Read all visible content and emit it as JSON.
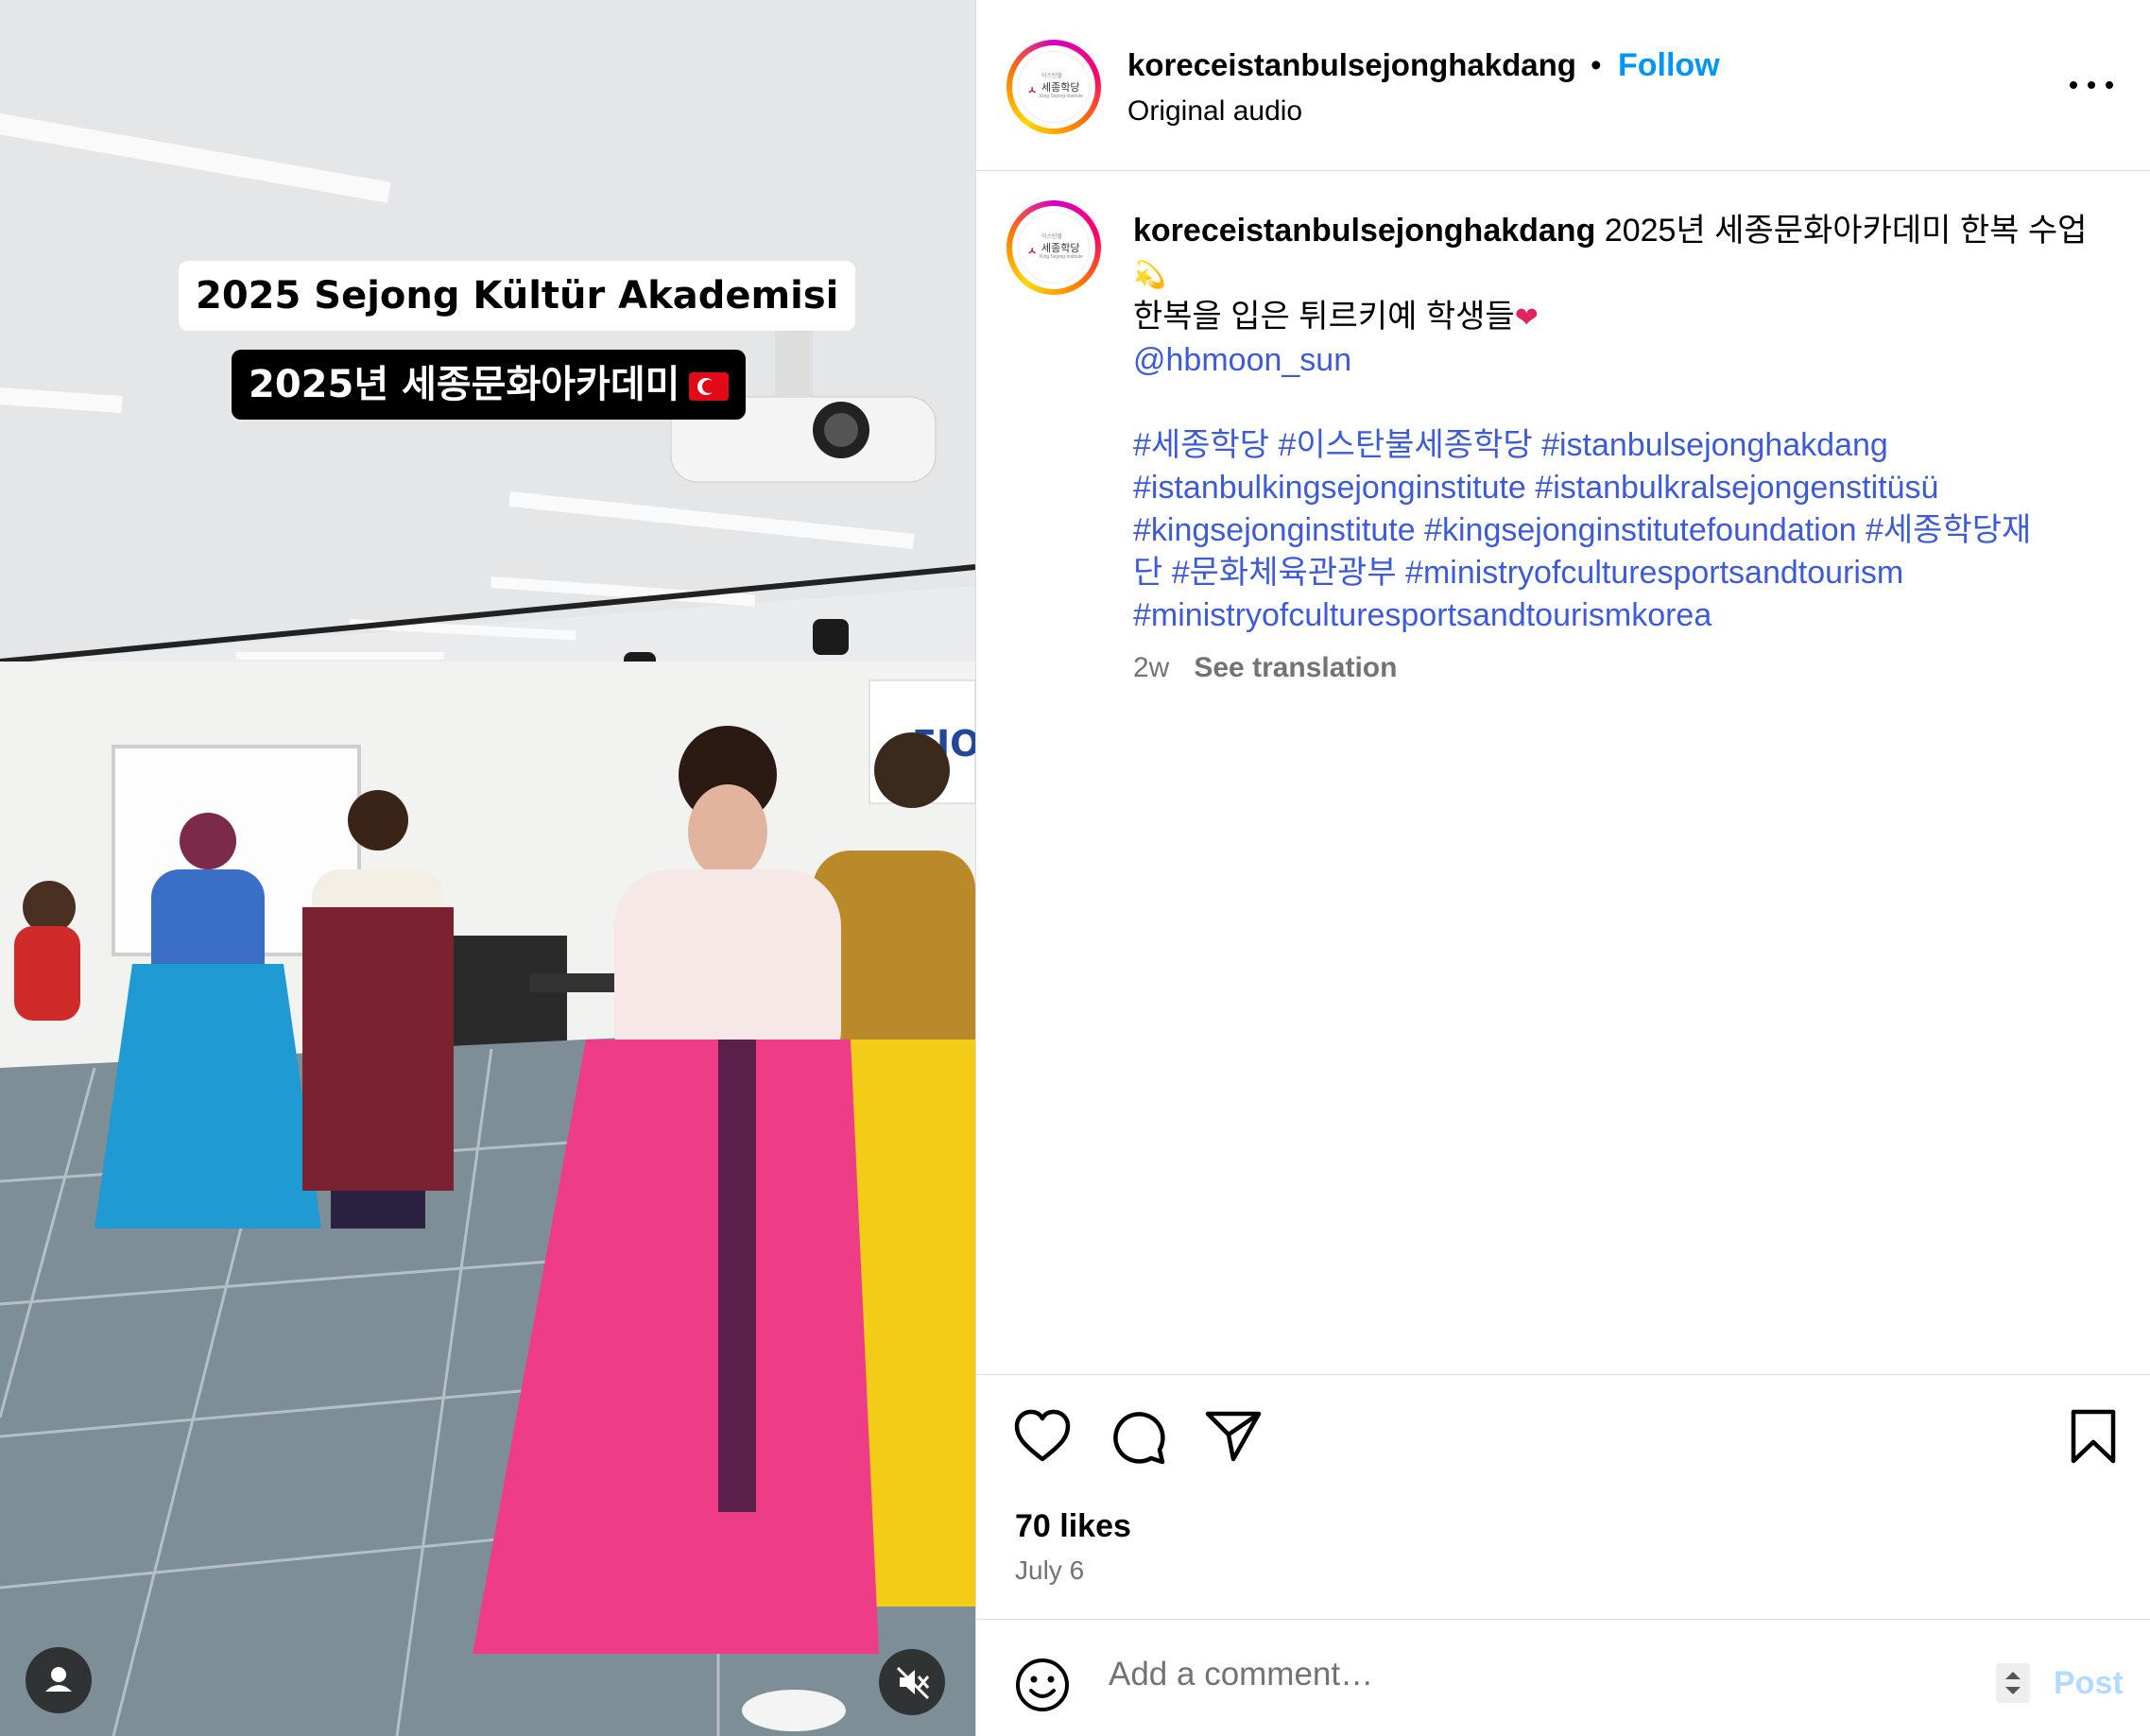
{
  "video": {
    "caption_line1": "2025 Sejong Kültür Akademisi",
    "caption_line2": "2025년 세종문화아카데미",
    "flag_icon": "turkey-flag-icon",
    "user_button_icon": "person-icon",
    "mute_button_icon": "speaker-muted-icon"
  },
  "header": {
    "username": "koreceistanbulsejonghakdang",
    "separator": "•",
    "follow_label": "Follow",
    "audio_label": "Original audio",
    "more_icon": "more-options-icon"
  },
  "avatar": {
    "logo_small": "이스탄불",
    "logo_korean": "세종학당",
    "logo_english": "King Sejong Institute",
    "ring_colors": [
      "#d300c5",
      "#ff0069",
      "#ff7a00",
      "#ffd600"
    ]
  },
  "caption": {
    "username": "koreceistanbulsejonghakdang",
    "text_line1": " 2025년 세종문화아카데미 한복 수업",
    "sparkle_emoji": "💫",
    "text_line2": "한복을 입은 튀르키예 학생들",
    "heart_emoji": "❤",
    "mention": "@hbmoon_sun",
    "hashtag_lines": [
      "#세종학당 #이스탄불세종학당 #istanbulsejonghakdang",
      "#istanbulkingsejonginstitute #istanbulkralsejongenstitüsü",
      "#kingsejonginstitute #kingsejonginstitutefoundation #세종학당재",
      "단 #문화체육관광부 #ministryofculturesportsandtourism",
      "#ministryofculturesportsandtourismkorea"
    ],
    "time_ago": "2w",
    "see_translation": "See translation"
  },
  "actions": {
    "like_icon": "heart-icon",
    "comment_icon": "comment-icon",
    "share_icon": "share-icon",
    "save_icon": "bookmark-icon"
  },
  "stats": {
    "likes": "70 likes",
    "date": "July 6"
  },
  "comment": {
    "emoji_icon": "emoji-icon",
    "placeholder": "Add a comment…",
    "post_label": "Post"
  },
  "colors": {
    "accent": "#0095f6",
    "link": "#3d5bd9",
    "muted_text": "#737373",
    "post_disabled": "#b3dbff",
    "divider": "#dbdbdb"
  }
}
